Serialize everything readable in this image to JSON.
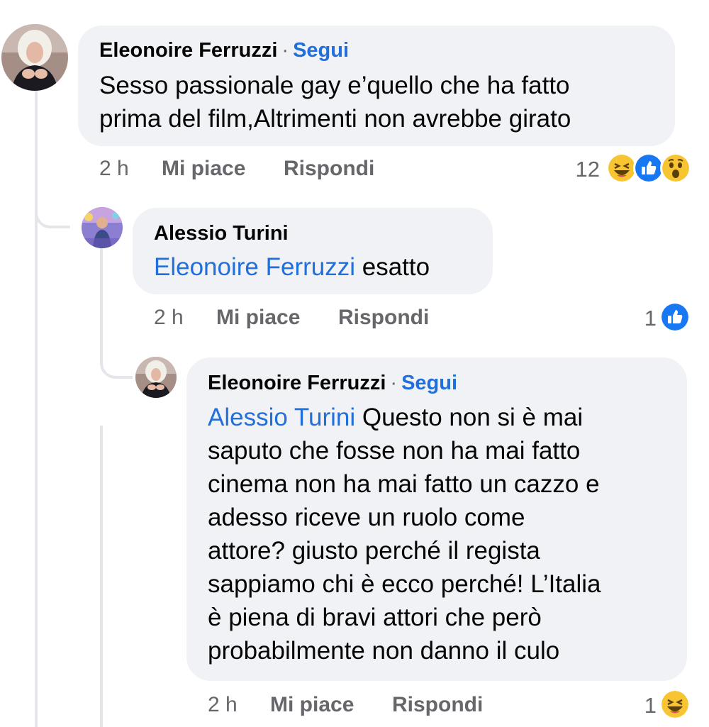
{
  "comments": [
    {
      "author": "Eleonoire Ferruzzi",
      "separator": "·",
      "follow": "Segui",
      "lines": [
        "Sesso passionale gay e’quello che ha fatto",
        "prima del film,Altrimenti non avrebbe girato"
      ],
      "time": "2 h",
      "like": "Mi piace",
      "reply": "Rispondi",
      "reaction_count": "12",
      "reactions": [
        "haha-icon",
        "like-icon",
        "wow-icon"
      ]
    },
    {
      "author": "Alessio Turini",
      "mention": "Eleonoire Ferruzzi",
      "text": " esatto",
      "time": "2 h",
      "like": "Mi piace",
      "reply": "Rispondi",
      "reaction_count": "1",
      "reactions": [
        "like-icon"
      ]
    },
    {
      "author": "Eleonoire Ferruzzi",
      "separator": "·",
      "follow": "Segui",
      "mention": "Alessio Turini",
      "first_line_rest": " Questo non si è mai",
      "lines": [
        "saputo che fosse non ha mai fatto",
        "cinema non ha mai fatto un cazzo e",
        "adesso riceve un ruolo come",
        "attore? giusto perché il regista",
        "sappiamo chi è ecco perché! L’Italia",
        "è piena di bravi attori che però",
        "probabilmente non danno il culo"
      ],
      "time": "2 h",
      "like": "Mi piace",
      "reply": "Rispondi",
      "reaction_count": "1",
      "reactions": [
        "haha-icon"
      ]
    }
  ],
  "colors": {
    "bubble": "#f0f2f5",
    "link": "#216fdb",
    "meta": "#65676b",
    "like_blue": "#1877f2",
    "emoji_yellow": "#f7c531"
  }
}
